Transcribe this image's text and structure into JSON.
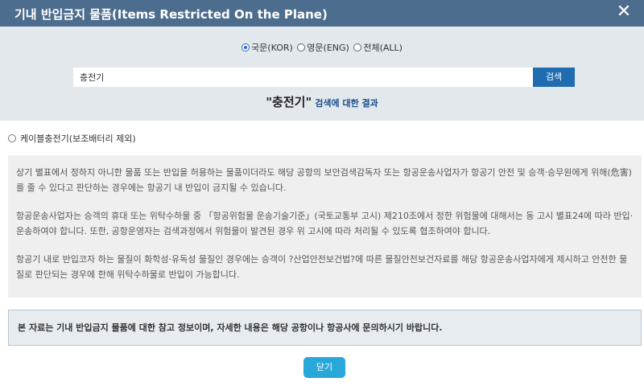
{
  "header": {
    "title": "기내 반입금지 물품(Items Restricted On the Plane)",
    "close_icon": "close-icon",
    "bg_color": "#4d6d8e"
  },
  "language_options": [
    {
      "label": "국문(KOR)",
      "selected": true
    },
    {
      "label": "영문(ENG)",
      "selected": false
    },
    {
      "label": "전체(ALL)",
      "selected": false
    }
  ],
  "search": {
    "value": "충전기",
    "placeholder": "",
    "button_label": "검색"
  },
  "result": {
    "keyword": "\"충전기\"",
    "suffix": "검색에 대한 결과"
  },
  "results": [
    {
      "label": "케이블충전기(보조배터리 제외)",
      "selected": false
    }
  ],
  "notice": {
    "paragraphs": [
      "상기 별표에서 정하지 아니한 물품 또는 반입을 허용하는 물품이더라도 해당 공항의 보안검색감독자 또는 항공운송사업자가 항공기 안전 및 승객·승무원에게 위해(危害)를 줄 수 있다고 판단하는 경우에는 항공기 내 반입이 금지될 수 있습니다.",
      "항공운송사업자는 승객의 휴대 또는 위탁수하물 중 「항공위험물 운송기술기준」(국토교통부 고시) 제210조에서 정한 위험물에 대해서는 동 고시 별표24에 따라 반입·운송하여야 합니다. 또한, 공항운영자는 검색과정에서 위험물이 발견된 경우 위 고시에 따라 처리될 수 있도록 협조하여야 합니다.",
      "항공기 내로 반입코자 하는 물질이 화학성·유독성 물질인 경우에는 승객이 ?산업안전보건법?에 따른 물질안전보건자료를 해당 항공운송사업자에게 제시하고 안전한 물질로 판단되는 경우에 한해 위탁수하물로 반입이 가능합니다."
    ]
  },
  "info": {
    "text": "본 자료는 기내 반입금지 물품에 대한 참고 정보이며, 자세한 내용은 해당 공항이나 항공사에 문의하시기 바랍니다."
  },
  "footer": {
    "close_label": "닫기",
    "close_color": "#27a8d8"
  },
  "colors": {
    "search_panel_bg": "#e3e8ed",
    "search_button_bg": "#1f6cb0",
    "notice_bg": "#efefef",
    "info_bg": "#e7ecf1"
  }
}
